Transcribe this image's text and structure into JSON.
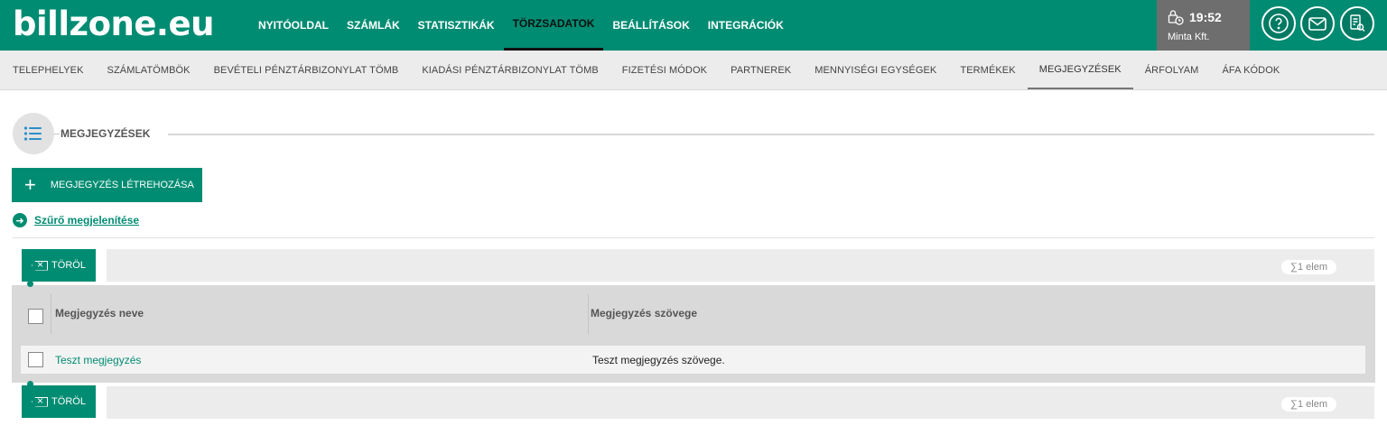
{
  "app": {
    "logo": "billzone.eu",
    "nav": [
      "NYITÓOLDAL",
      "SZÁMLÁK",
      "STATISZTIKÁK",
      "TÖRZSADATOK",
      "BEÁLLÍTÁSOK",
      "INTEGRÁCIÓK"
    ],
    "active_nav": "TÖRZSADATOK",
    "time": "19:52",
    "company": "Minta Kft.",
    "accent_color": "#008c72"
  },
  "subnav": {
    "items": [
      "TELEPHELYEK",
      "SZÁMLATÖMBÖK",
      "BEVÉTELI PÉNZTÁRBIZONYLAT TÖMB",
      "KIADÁSI PÉNZTÁRBIZONYLAT TÖMB",
      "FIZETÉSI MÓDOK",
      "PARTNEREK",
      "MENNYISÉGI EGYSÉGEK",
      "TERMÉKEK",
      "MEGJEGYZÉSEK",
      "ÁRFOLYAM",
      "ÁFA KÓDOK"
    ],
    "active": "MEGJEGYZÉSEK"
  },
  "section": {
    "title": "MEGJEGYZÉSEK",
    "create_label": "MEGJEGYZÉS LÉTREHOZÁSA",
    "filter_label": "Szűrő megjelenítése"
  },
  "table": {
    "delete_label": "TÖRÖL",
    "count_label": "∑1 elem",
    "columns": [
      "Megjegyzés neve",
      "Megjegyzés szövege"
    ],
    "rows": [
      {
        "name": "Teszt megjegyzés",
        "text": "Teszt megjegyzés szövege."
      }
    ]
  }
}
